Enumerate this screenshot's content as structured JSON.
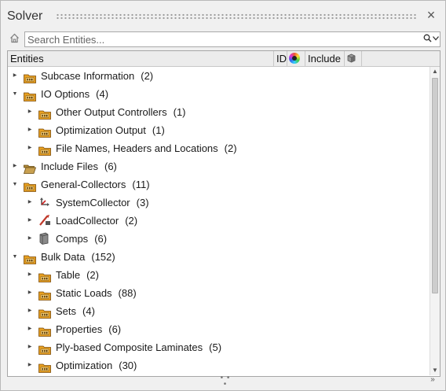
{
  "panel": {
    "title": "Solver",
    "close_icon": "×"
  },
  "search": {
    "placeholder": "Search Entities..."
  },
  "columns": {
    "entities": "Entities",
    "id": "ID",
    "include": "Include"
  },
  "tree": [
    {
      "label": "Subcase Information",
      "count": "(2)",
      "level": 0,
      "expanded": false,
      "icon": "folder-icon"
    },
    {
      "label": "IO Options",
      "count": "(4)",
      "level": 0,
      "expanded": true,
      "icon": "folder-icon"
    },
    {
      "label": "Other Output Controllers",
      "count": "(1)",
      "level": 1,
      "expanded": false,
      "icon": "folder-icon"
    },
    {
      "label": "Optimization Output",
      "count": "(1)",
      "level": 1,
      "expanded": false,
      "icon": "folder-icon"
    },
    {
      "label": "File Names, Headers and Locations",
      "count": "(2)",
      "level": 1,
      "expanded": false,
      "icon": "folder-icon"
    },
    {
      "label": "Include Files",
      "count": "(6)",
      "level": 0,
      "expanded": false,
      "icon": "open-folder-icon"
    },
    {
      "label": "General-Collectors",
      "count": "(11)",
      "level": 0,
      "expanded": true,
      "icon": "folder-icon"
    },
    {
      "label": "SystemCollector",
      "count": "(3)",
      "level": 1,
      "expanded": false,
      "icon": "system-collector-icon"
    },
    {
      "label": "LoadCollector",
      "count": "(2)",
      "level": 1,
      "expanded": false,
      "icon": "load-collector-icon"
    },
    {
      "label": "Comps",
      "count": "(6)",
      "level": 1,
      "expanded": false,
      "icon": "component-icon"
    },
    {
      "label": "Bulk Data",
      "count": "(152)",
      "level": 0,
      "expanded": true,
      "icon": "folder-icon"
    },
    {
      "label": "Table",
      "count": "(2)",
      "level": 1,
      "expanded": false,
      "icon": "folder-icon"
    },
    {
      "label": "Static Loads",
      "count": "(88)",
      "level": 1,
      "expanded": false,
      "icon": "folder-icon"
    },
    {
      "label": "Sets",
      "count": "(4)",
      "level": 1,
      "expanded": false,
      "icon": "folder-icon"
    },
    {
      "label": "Properties",
      "count": "(6)",
      "level": 1,
      "expanded": false,
      "icon": "folder-icon"
    },
    {
      "label": "Ply-based Composite Laminates",
      "count": "(5)",
      "level": 1,
      "expanded": false,
      "icon": "folder-icon"
    },
    {
      "label": "Optimization",
      "count": "(30)",
      "level": 1,
      "expanded": false,
      "icon": "folder-icon"
    }
  ],
  "colors": {
    "folder": "#e8a020",
    "folder_dark": "#7a4a08",
    "panel_bg": "#f0f0f0",
    "grid_bg": "#ffffff"
  }
}
